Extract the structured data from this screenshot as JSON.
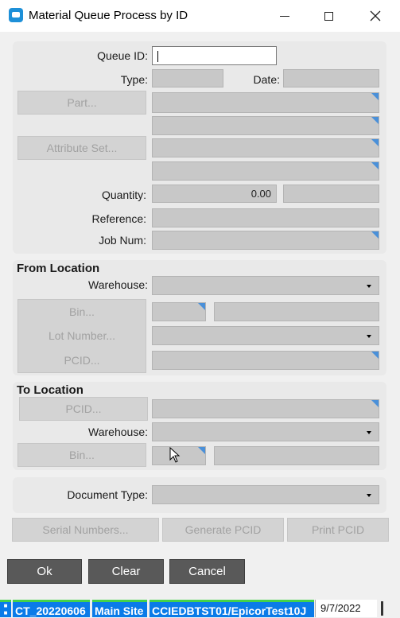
{
  "window": {
    "title": "Material Queue Process by ID"
  },
  "main": {
    "queue_id_label": "Queue ID:",
    "queue_id_value": "",
    "type_label": "Type:",
    "date_label": "Date:",
    "part_button": "Part...",
    "attribute_set_button": "Attribute Set...",
    "quantity_label": "Quantity:",
    "quantity_value": "0.00",
    "reference_label": "Reference:",
    "job_num_label": "Job Num:"
  },
  "from_location": {
    "title": "From Location",
    "warehouse_label": "Warehouse:",
    "bin_button": "Bin...",
    "lot_number_button": "Lot Number...",
    "pcid_button": "PCID..."
  },
  "to_location": {
    "title": "To Location",
    "pcid_button": "PCID...",
    "warehouse_label": "Warehouse:",
    "bin_button": "Bin..."
  },
  "document": {
    "type_label": "Document Type:"
  },
  "actions": {
    "serial_numbers": "Serial Numbers...",
    "generate_pcid": "Generate PCID",
    "print_pcid": "Print PCID",
    "ok": "Ok",
    "clear": "Clear",
    "cancel": "Cancel"
  },
  "status_bar": {
    "company": "CT_20220606",
    "site": "Main Site",
    "server": "CCIEDBTST01/EpicorTest10J",
    "date": "9/7/2022"
  },
  "icons": {
    "app": "app-window-icon",
    "minimize": "minimize-icon",
    "maximize": "maximize-icon",
    "close": "close-icon",
    "cursor": "mouse-pointer-icon"
  },
  "colors": {
    "accent_blue": "#0a7be8",
    "status_green": "#44d24a",
    "field_gray": "#c8c8c8",
    "dark_button": "#595959"
  }
}
